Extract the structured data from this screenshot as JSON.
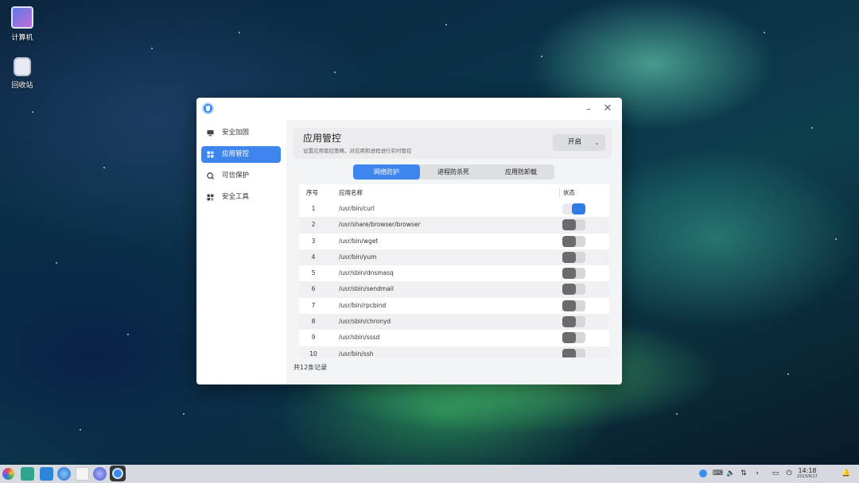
{
  "desktop": {
    "icons": [
      {
        "label": "计算机",
        "icon": "computer-icon"
      },
      {
        "label": "回收站",
        "icon": "trash-icon"
      }
    ]
  },
  "window": {
    "controls": {
      "minimize": "–",
      "close": "✕"
    },
    "sidebar": {
      "items": [
        {
          "label": "安全加固",
          "icon": "monitor-icon",
          "active": false
        },
        {
          "label": "应用管控",
          "icon": "app-control-icon",
          "active": true
        },
        {
          "label": "可信保护",
          "icon": "trusted-shield-icon",
          "active": false
        },
        {
          "label": "安全工具",
          "icon": "toolbox-icon",
          "active": false
        }
      ]
    },
    "header": {
      "title": "应用管控",
      "description": "设置应用管控策略，对应用和进程进行实时管控",
      "select_value": "开启",
      "select_chevron": "⌄"
    },
    "tabs": [
      {
        "label": "网络防护",
        "active": true
      },
      {
        "label": "进程防杀死",
        "active": false
      },
      {
        "label": "应用防卸载",
        "active": false
      }
    ],
    "table": {
      "columns": [
        "序号",
        "应用名称",
        "状态"
      ],
      "rows": [
        {
          "index": "1",
          "name": "/usr/bin/curl",
          "enabled": true
        },
        {
          "index": "2",
          "name": "/usr/share/browser/browser",
          "enabled": false
        },
        {
          "index": "3",
          "name": "/usr/bin/wget",
          "enabled": false
        },
        {
          "index": "4",
          "name": "/usr/bin/yum",
          "enabled": false
        },
        {
          "index": "5",
          "name": "/usr/sbin/dnsmasq",
          "enabled": false
        },
        {
          "index": "6",
          "name": "/usr/sbin/sendmail",
          "enabled": false
        },
        {
          "index": "7",
          "name": "/usr/bin/rpcbind",
          "enabled": false
        },
        {
          "index": "8",
          "name": "/usr/sbin/chronyd",
          "enabled": false
        },
        {
          "index": "9",
          "name": "/usr/sbin/sssd",
          "enabled": false
        },
        {
          "index": "10",
          "name": "/usr/bin/ssh",
          "enabled": false
        }
      ]
    },
    "footer": {
      "count_text": "共12条记录"
    }
  },
  "taskbar": {
    "clock_time": "14:18",
    "clock_date": "2023/8/17",
    "accent_color": "#3e86ee"
  }
}
